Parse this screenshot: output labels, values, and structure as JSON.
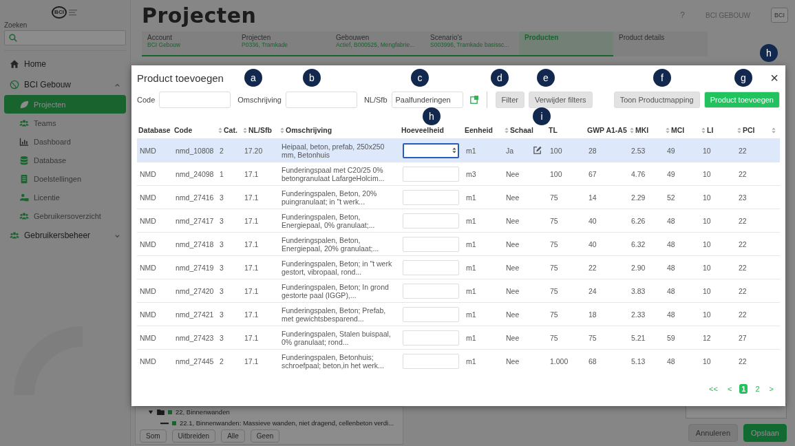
{
  "sidebar": {
    "logo": "BCI",
    "search_label": "Zoeken",
    "items": [
      {
        "label": "Home",
        "selected": false
      },
      {
        "label": "BCI Gebouw",
        "selected": false,
        "expanded": true,
        "children": [
          {
            "label": "Projecten",
            "selected": true
          },
          {
            "label": "Teams",
            "selected": false
          },
          {
            "label": "Dashboard",
            "selected": false
          },
          {
            "label": "Database",
            "selected": false
          },
          {
            "label": "Doelstellingen",
            "selected": false
          },
          {
            "label": "Licentie",
            "selected": false
          },
          {
            "label": "Gebruikersoverzicht",
            "selected": false
          }
        ]
      },
      {
        "label": "Gebruikersbeheer",
        "selected": false,
        "expanded": false
      }
    ]
  },
  "header": {
    "title": "Projecten",
    "help": "?",
    "user": "BCI GEBOUW",
    "avatar": "BCI"
  },
  "breadcrumbs": [
    {
      "label": "Account",
      "value": "BCI Gebouw",
      "selected": false,
      "done": true
    },
    {
      "label": "Projecten",
      "value": "P0336, Tramkade",
      "selected": false,
      "done": true
    },
    {
      "label": "Gebouwen",
      "value": "Actief, B000525, Mengfabrie...",
      "selected": false,
      "done": true
    },
    {
      "label": "Scenario's",
      "value": "S003996, Tramkade basissc...",
      "selected": false,
      "done": true
    },
    {
      "label": "Producten",
      "selected": true,
      "done": true
    },
    {
      "label": "Product details",
      "selected": false,
      "done": false
    }
  ],
  "tree": [
    {
      "label": "22, Binnenwanden",
      "expanded": true,
      "children": [
        {
          "label": "22.1, Binnenwanden: Massieve wanden, niet dragend, cellenbeton verdi..."
        }
      ]
    }
  ],
  "tree_buttons": [
    "Som",
    "Uitbreiden",
    "Alle",
    "Geen"
  ],
  "form_buttons": [
    {
      "label": "Annuleren",
      "kind": "secondary"
    },
    {
      "label": "Opslaan",
      "kind": "primary"
    }
  ],
  "modal": {
    "title": "Product toevoegen",
    "close": "×",
    "filters": [
      {
        "label": "Code"
      },
      {
        "label": "Omschrijving"
      },
      {
        "label": "NL/Sfb",
        "value": "Paalfunderingen"
      }
    ],
    "buttons": [
      {
        "label": "Filter",
        "kind": "secondary"
      },
      {
        "label": "Verwijder filters",
        "kind": "secondary"
      },
      {
        "label": "Toon Productmapping",
        "kind": "secondary"
      },
      {
        "label": "Product toevoegen",
        "kind": "primary"
      }
    ],
    "columns": [
      {
        "label": "Database",
        "sortable": false
      },
      {
        "label": "Code",
        "sortable": false
      },
      {
        "label": "Cat.",
        "sortable": true
      },
      {
        "label": "NL/Sfb",
        "sortable": true
      },
      {
        "label": "Omschrijving",
        "sortable": true
      },
      {
        "label": "Hoeveelheid",
        "sortable": false
      },
      {
        "label": "Eenheid",
        "sortable": false
      },
      {
        "label": "Schaal",
        "sortable": true
      },
      {
        "label": "TL",
        "sortable": false
      },
      {
        "label": "GWP A1-A5",
        "sortable": false
      },
      {
        "label": "MKI",
        "sortable": true
      },
      {
        "label": "MCI",
        "sortable": true
      },
      {
        "label": "LI",
        "sortable": true
      },
      {
        "label": "PCI",
        "sortable": true
      },
      {
        "sortable": true
      }
    ],
    "rows": [
      {
        "selected": true,
        "focused": true,
        "editable": true,
        "database": "NMD",
        "code": "nmd_10808",
        "cat": "2",
        "nlsfb": "17.20",
        "omschrijving": "Heipaal, beton, prefab, 250x250 mm, Betonhuis",
        "eenheid": "m1",
        "schaal": "Ja",
        "tl": "100",
        "gwp": "28",
        "mki": "2.53",
        "mci": "49",
        "li": "10",
        "pci": "22"
      },
      {
        "selected": false,
        "focused": false,
        "editable": false,
        "database": "NMD",
        "code": "nmd_24098",
        "cat": "1",
        "nlsfb": "17.1",
        "omschrijving": "Funderingspaal met C20/25 0% betongranulaat LafargeHolcim...",
        "eenheid": "m3",
        "schaal": "Nee",
        "tl": "100",
        "gwp": "67",
        "mki": "4.76",
        "mci": "49",
        "li": "10",
        "pci": "22"
      },
      {
        "selected": false,
        "focused": false,
        "editable": false,
        "database": "NMD",
        "code": "nmd_27416",
        "cat": "3",
        "nlsfb": "17.1",
        "omschrijving": "Funderingspalen, Beton, 20% puingranulaat; in \"t werk...",
        "eenheid": "m1",
        "schaal": "Nee",
        "tl": "75",
        "gwp": "14",
        "mki": "2.29",
        "mci": "52",
        "li": "10",
        "pci": "23"
      },
      {
        "selected": false,
        "focused": false,
        "editable": false,
        "database": "NMD",
        "code": "nmd_27417",
        "cat": "3",
        "nlsfb": "17.1",
        "omschrijving": "Funderingspalen, Beton, Energiepaal, 0% granulaat;...",
        "eenheid": "m1",
        "schaal": "Nee",
        "tl": "75",
        "gwp": "40",
        "mki": "6.26",
        "mci": "48",
        "li": "10",
        "pci": "22"
      },
      {
        "selected": false,
        "focused": false,
        "editable": false,
        "database": "NMD",
        "code": "nmd_27418",
        "cat": "3",
        "nlsfb": "17.1",
        "omschrijving": "Funderingspalen, Beton, Energiepaal, 20% granulaat;...",
        "eenheid": "m1",
        "schaal": "Nee",
        "tl": "75",
        "gwp": "40",
        "mki": "6.32",
        "mci": "48",
        "li": "10",
        "pci": "22"
      },
      {
        "selected": false,
        "focused": false,
        "editable": false,
        "database": "NMD",
        "code": "nmd_27419",
        "cat": "3",
        "nlsfb": "17.1",
        "omschrijving": "Funderingspalen, Beton; in \"t werk gestort, vibropaal, rond...",
        "eenheid": "m1",
        "schaal": "Nee",
        "tl": "75",
        "gwp": "22",
        "mki": "2.90",
        "mci": "48",
        "li": "10",
        "pci": "22"
      },
      {
        "selected": false,
        "focused": false,
        "editable": false,
        "database": "NMD",
        "code": "nmd_27420",
        "cat": "3",
        "nlsfb": "17.1",
        "omschrijving": "Funderingspalen, Beton; In grond gestorte paal (IGGP),...",
        "eenheid": "m1",
        "schaal": "Nee",
        "tl": "75",
        "gwp": "24",
        "mki": "3.83",
        "mci": "48",
        "li": "10",
        "pci": "22"
      },
      {
        "selected": false,
        "focused": false,
        "editable": false,
        "database": "NMD",
        "code": "nmd_27421",
        "cat": "3",
        "nlsfb": "17.1",
        "omschrijving": "Funderingspalen, Beton; Prefab, met gewichtsbesparend...",
        "eenheid": "m1",
        "schaal": "Nee",
        "tl": "75",
        "gwp": "18",
        "mki": "2.33",
        "mci": "48",
        "li": "10",
        "pci": "22"
      },
      {
        "selected": false,
        "focused": false,
        "editable": false,
        "database": "NMD",
        "code": "nmd_27423",
        "cat": "3",
        "nlsfb": "17.1",
        "omschrijving": "Funderingspalen, Stalen buispaal, 0% granulaat; rond...",
        "eenheid": "m1",
        "schaal": "Nee",
        "tl": "75",
        "gwp": "75",
        "mki": "5.21",
        "mci": "59",
        "li": "12",
        "pci": "27"
      },
      {
        "selected": false,
        "focused": false,
        "editable": false,
        "database": "NMD",
        "code": "nmd_27445",
        "cat": "2",
        "nlsfb": "17.1",
        "omschrijving": "Funderingspalen, Betonhuis; schroefpaal; beton,in het werk...",
        "eenheid": "m1",
        "schaal": "Nee",
        "tl": "1.000",
        "gwp": "68",
        "mki": "5.13",
        "mci": "48",
        "li": "10",
        "pci": "22"
      }
    ],
    "pagination": [
      {
        "label": "<<",
        "selected": false
      },
      {
        "label": "<",
        "selected": false
      },
      {
        "label": "1",
        "selected": true
      },
      {
        "label": "2",
        "selected": false
      },
      {
        "label": ">",
        "selected": false
      }
    ]
  },
  "annotations": [
    {
      "label": "a"
    },
    {
      "label": "b"
    },
    {
      "label": "c"
    },
    {
      "label": "d"
    },
    {
      "label": "e"
    },
    {
      "label": "f"
    },
    {
      "label": "g"
    },
    {
      "label": "h"
    },
    {
      "label": "h"
    },
    {
      "label": "i"
    }
  ]
}
